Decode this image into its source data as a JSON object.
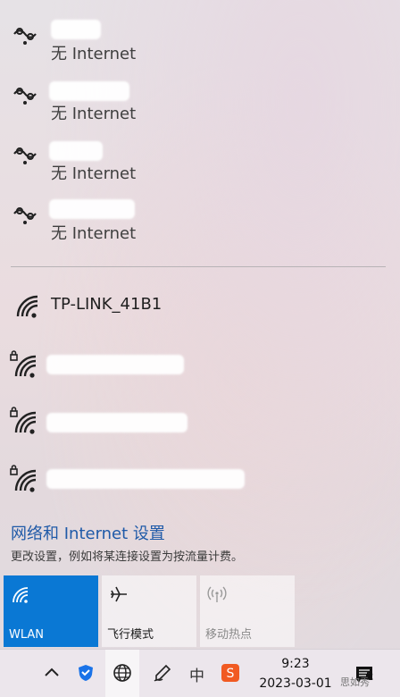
{
  "networks_saved": [
    {
      "status": "无 Internet"
    },
    {
      "status": "无 Internet"
    },
    {
      "status": "无 Internet"
    },
    {
      "status": "无 Internet"
    }
  ],
  "networks_available": [
    {
      "name": "TP-LINK_41B1"
    },
    {
      "name": ""
    },
    {
      "name": ""
    },
    {
      "name": ""
    }
  ],
  "settings": {
    "link_text": "网络和 Internet 设置",
    "description": "更改设置，例如将某连接设置为按流量计费。"
  },
  "quick_actions": [
    {
      "label": "WLAN",
      "icon": "wifi-icon",
      "state": "on"
    },
    {
      "label": "飞行模式",
      "icon": "airplane-icon",
      "state": "off"
    },
    {
      "label": "移动热点",
      "icon": "hotspot-icon",
      "state": "disabled"
    }
  ],
  "taskbar": {
    "time": "9:23",
    "date": "2023-03-01",
    "ime_label": "中",
    "notification_count": "2",
    "watermark": "思如秀"
  },
  "colors": {
    "accent": "#0a78d4",
    "link": "#1f5aa8"
  }
}
